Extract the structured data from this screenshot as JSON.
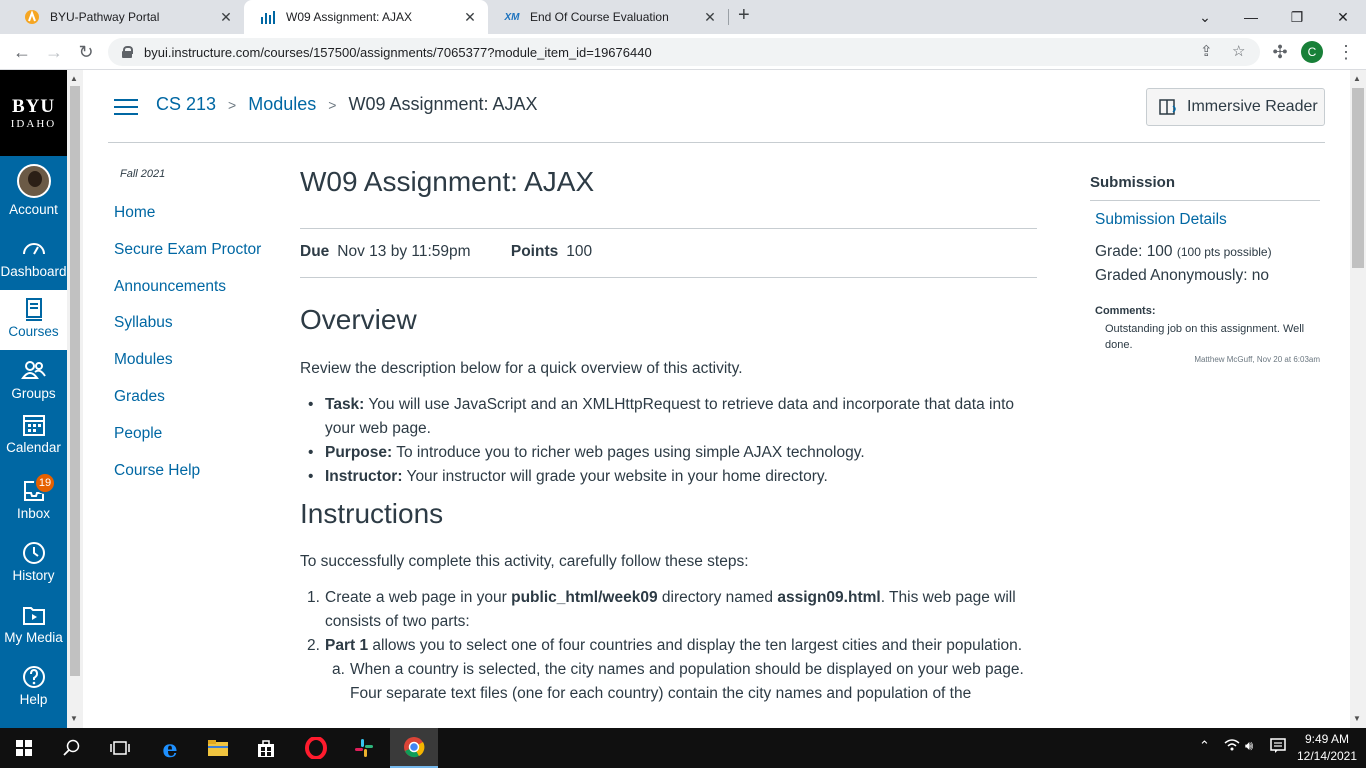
{
  "browser": {
    "tabs": [
      {
        "title": "BYU-Pathway Portal",
        "active": false
      },
      {
        "title": "W09 Assignment: AJAX",
        "active": true
      },
      {
        "title": "End Of Course Evaluation",
        "active": false
      }
    ],
    "url": "byui.instructure.com/courses/157500/assignments/7065377?module_item_id=19676440",
    "profile_initial": "C"
  },
  "global_nav": {
    "logo_top": "BYU",
    "logo_bottom": "IDAHO",
    "items": [
      {
        "label": "Account"
      },
      {
        "label": "Dashboard"
      },
      {
        "label": "Courses"
      },
      {
        "label": "Groups"
      },
      {
        "label": "Calendar"
      },
      {
        "label": "Inbox",
        "badge": "19"
      },
      {
        "label": "History"
      },
      {
        "label": "My Media"
      },
      {
        "label": "Help"
      }
    ]
  },
  "header": {
    "breadcrumbs": [
      "CS 213",
      "Modules",
      "W09 Assignment: AJAX"
    ],
    "immersive_reader": "Immersive Reader"
  },
  "course_nav": {
    "term": "Fall 2021",
    "items": [
      "Home",
      "Secure Exam Proctor",
      "Announcements",
      "Syllabus",
      "Modules",
      "Grades",
      "People",
      "Course Help"
    ]
  },
  "assignment": {
    "title": "W09 Assignment: AJAX",
    "due_label": "Due",
    "due_value": "Nov 13 by 11:59pm",
    "points_label": "Points",
    "points_value": "100",
    "overview_heading": "Overview",
    "overview_text": "Review the description below for a quick overview of this activity.",
    "bullets": [
      {
        "bold": "Task:",
        "text": " You will use JavaScript and an XMLHttpRequest to retrieve data and incorporate that data into your web page."
      },
      {
        "bold": "Purpose:",
        "text": " To introduce you to richer web pages using simple AJAX technology."
      },
      {
        "bold": "Instructor:",
        "text": " Your instructor will grade your website in your home directory."
      }
    ],
    "instructions_heading": "Instructions",
    "instructions_text": "To successfully complete this activity, carefully follow these steps:",
    "step1_num": "1.",
    "step1_a": "Create a web page in your ",
    "step1_b": "public_html/week09",
    "step1_c": " directory named ",
    "step1_d": "assign09.html",
    "step1_e": ". This web page will consists of two parts:",
    "step2_num": "2.",
    "step2_bold": "Part 1",
    "step2_text": " allows you to select one of four countries and display the ten largest cities and their population.",
    "step2a_num": "a.",
    "step2a_text": "When a country is selected, the city names and population should be displayed on your web page. Four separate text files (one for each country) contain the city names and population of the"
  },
  "sidebar": {
    "heading": "Submission",
    "details_link": "Submission Details",
    "grade_label": "Grade: 100",
    "grade_possible": "(100 pts possible)",
    "anonymous": "Graded Anonymously: no",
    "comments_label": "Comments:",
    "comment_text": "Outstanding job on this assignment. Well done.",
    "comment_author": "Matthew McGuff, Nov 20 at 6:03am"
  },
  "taskbar": {
    "time": "9:49 AM",
    "date": "12/14/2021"
  },
  "colors": {
    "canvas_blue": "#0067a3",
    "text": "#2d3b45",
    "badge": "#e66000"
  }
}
